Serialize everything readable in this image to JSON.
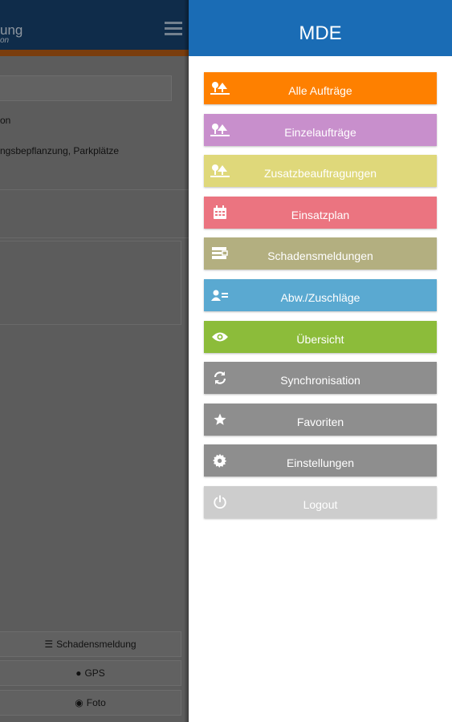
{
  "background_app": {
    "title": "ung",
    "subtitle": "on",
    "text1": "on",
    "text2": "ngsbepflanzung, Parkplätze",
    "buttons": [
      {
        "icon": "report-icon",
        "label": "Schadensmeldung"
      },
      {
        "icon": "globe-icon",
        "label": "GPS"
      },
      {
        "icon": "camera-icon",
        "label": "Foto"
      }
    ]
  },
  "drawer": {
    "title": "MDE",
    "items": [
      {
        "label": "Alle Aufträge",
        "color": "#fe8000",
        "icon": "trees-icon"
      },
      {
        "label": "Einzelaufträge",
        "color": "#c88fcc",
        "icon": "trees-icon"
      },
      {
        "label": "Zusatzbeauftragungen",
        "color": "#dfd87a",
        "icon": "trees-icon"
      },
      {
        "label": "Einsatzplan",
        "color": "#eb7480",
        "icon": "calendar-icon"
      },
      {
        "label": "Schadensmeldungen",
        "color": "#b3af80",
        "icon": "report-icon"
      },
      {
        "label": "Abw./Zuschläge",
        "color": "#5aa9d1",
        "icon": "user-list-icon"
      },
      {
        "label": "Übersicht",
        "color": "#8cbc3a",
        "icon": "eye-icon"
      },
      {
        "label": "Synchronisation",
        "color": "#8e8e8e",
        "icon": "sync-icon"
      },
      {
        "label": "Favoriten",
        "color": "#8e8e8e",
        "icon": "star-icon"
      },
      {
        "label": "Einstellungen",
        "color": "#8e8e8e",
        "icon": "gear-icon"
      },
      {
        "label": "Logout",
        "color": "#cdcdcd",
        "icon": "power-icon"
      }
    ]
  }
}
